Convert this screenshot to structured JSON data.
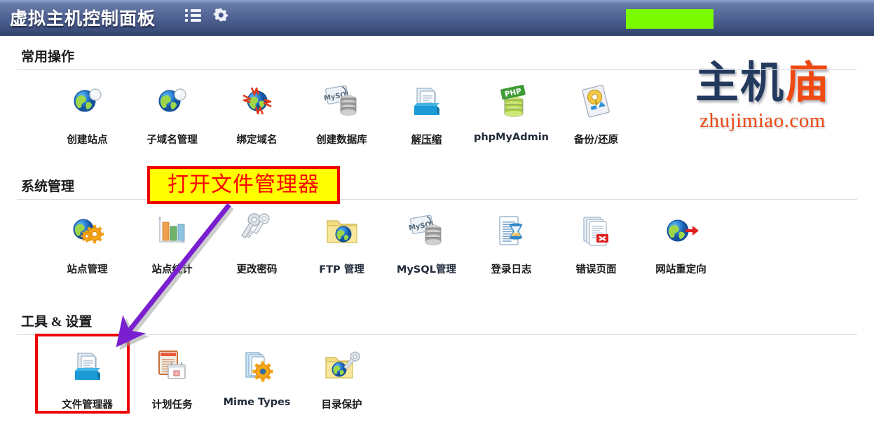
{
  "header": {
    "title": "虚拟主机控制面板",
    "menu_icon": "list-icon",
    "settings_icon": "gear-icon",
    "redaction_color": "#7cfc00"
  },
  "watermark": {
    "text_dark": "主机",
    "text_accent": "庙",
    "url": "zhujimiao.com",
    "dark_color": "#23395e",
    "accent_color": "#f04a14"
  },
  "annotations": {
    "callout_text": "打开文件管理器",
    "callout_bg": "#ffff00",
    "callout_border": "#ee0000",
    "callout_text_color": "#ff0000",
    "highlight_border": "#ee0000",
    "arrow_color": "#7a1fd0"
  },
  "sections": [
    {
      "title": "常用操作",
      "items": [
        {
          "label": "创建站点",
          "icon": "globe-icon",
          "style": "normal"
        },
        {
          "label": "子域名管理",
          "icon": "globe-icon",
          "style": "normal"
        },
        {
          "label": "绑定域名",
          "icon": "globe-bind-icon",
          "style": "normal"
        },
        {
          "label": "创建数据库",
          "icon": "mysql-db-icon",
          "style": "normal"
        },
        {
          "label": "解压缩",
          "icon": "archive-icon",
          "style": "link"
        },
        {
          "label": "phpMyAdmin",
          "icon": "php-db-icon",
          "style": "dark"
        },
        {
          "label": "备份/还原",
          "icon": "backup-icon",
          "style": "normal"
        }
      ]
    },
    {
      "title": "系统管理",
      "items": [
        {
          "label": "站点管理",
          "icon": "globe-gear-icon",
          "style": "normal"
        },
        {
          "label": "站点统计",
          "icon": "bar-chart-icon",
          "style": "normal"
        },
        {
          "label": "更改密码",
          "icon": "keys-icon",
          "style": "normal"
        },
        {
          "label": "FTP 管理",
          "icon": "folder-globe-icon",
          "style": "dark"
        },
        {
          "label": "MySQL管理",
          "icon": "mysql-db-icon",
          "style": "dark"
        },
        {
          "label": "登录日志",
          "icon": "log-hourglass-icon",
          "style": "normal"
        },
        {
          "label": "错误页面",
          "icon": "error-pages-icon",
          "style": "normal"
        },
        {
          "label": "网站重定向",
          "icon": "globe-arrow-icon",
          "style": "normal"
        }
      ]
    },
    {
      "title": "工具 & 设置",
      "items": [
        {
          "label": "文件管理器",
          "icon": "file-manager-icon",
          "style": "normal"
        },
        {
          "label": "计划任务",
          "icon": "cron-calendar-icon",
          "style": "normal"
        },
        {
          "label": "Mime Types",
          "icon": "mime-gear-icon",
          "style": "dark"
        },
        {
          "label": "目录保护",
          "icon": "folder-key-icon",
          "style": "normal"
        }
      ]
    }
  ]
}
